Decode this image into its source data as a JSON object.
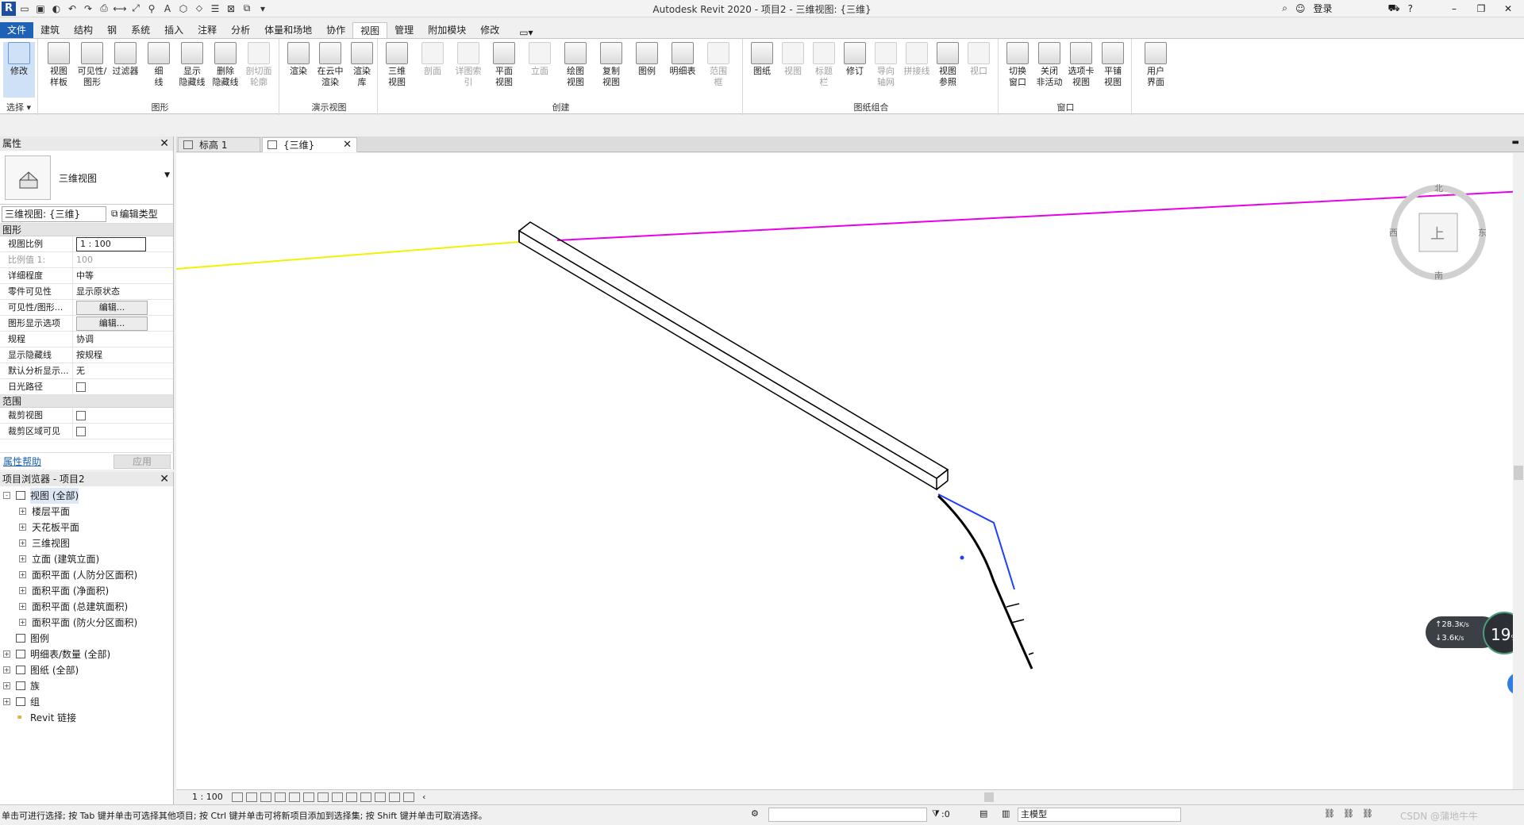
{
  "app": {
    "title": "Autodesk Revit 2020 - 项目2 - 三维视图: {三维}",
    "login": "登录",
    "logo": "R",
    "title_icons": [
      "binoculars-icon",
      "user-icon",
      "cart-icon",
      "help-icon"
    ]
  },
  "ribbon_tabs": [
    "文件",
    "建筑",
    "结构",
    "钢",
    "系统",
    "插入",
    "注释",
    "分析",
    "体量和场地",
    "协作",
    "视图",
    "管理",
    "附加模块",
    "修改"
  ],
  "ribbon": {
    "select": {
      "modify": "修改",
      "panel": "选择 ▾"
    },
    "graphics": {
      "panel": "图形",
      "buttons": [
        "视图\n样板",
        "可见性/\n图形",
        "过滤器",
        "细\n线",
        "显示\n隐藏线",
        "删除\n隐藏线",
        "剖切面\n轮廓"
      ]
    },
    "presentation": {
      "panel": "演示视图",
      "buttons": [
        "渲染",
        "在云中\n渲染",
        "渲染\n库"
      ]
    },
    "create": {
      "panel": "创建",
      "buttons": [
        "三维\n视图",
        "剖面",
        "详图索引",
        "平面\n视图",
        "立面",
        "绘图\n视图",
        "复制\n视图",
        "图例",
        "明细表",
        "范围\n框"
      ]
    },
    "sheet": {
      "panel": "图纸组合",
      "buttons": [
        "图纸",
        "视图",
        "标题\n栏",
        "修订",
        "导向\n轴网",
        "拼接线",
        "视图\n参照",
        "视口"
      ]
    },
    "windows": {
      "panel": "窗口",
      "buttons": [
        "切换\n窗口",
        "关闭\n非活动",
        "选项卡\n视图",
        "平铺\n视图"
      ]
    },
    "ui": {
      "buttons": [
        "用户\n界面"
      ]
    }
  },
  "properties": {
    "title": "属性",
    "type_name": "三维视图",
    "instance_selector": "三维视图: {三维}",
    "edit_type": "编辑类型",
    "groups": [
      {
        "name": "图形",
        "rows": [
          {
            "k": "视图比例",
            "v": "1 : 100"
          },
          {
            "k": "比例值 1:",
            "v": "100"
          },
          {
            "k": "详细程度",
            "v": "中等"
          },
          {
            "k": "零件可见性",
            "v": "显示原状态"
          },
          {
            "k": "可见性/图形...",
            "v": "编辑..."
          },
          {
            "k": "图形显示选项",
            "v": "编辑..."
          },
          {
            "k": "规程",
            "v": "协调"
          },
          {
            "k": "显示隐藏线",
            "v": "按规程"
          },
          {
            "k": "默认分析显示...",
            "v": "无"
          },
          {
            "k": "日光路径",
            "v": ""
          }
        ]
      },
      {
        "name": "范围",
        "rows": [
          {
            "k": "裁剪视图",
            "v": ""
          },
          {
            "k": "裁剪区域可见",
            "v": ""
          }
        ]
      }
    ],
    "help_link": "属性帮助",
    "apply": "应用"
  },
  "browser": {
    "title": "项目浏览器 - 项目2",
    "items": [
      {
        "label": "视图 (全部)",
        "level": 0,
        "exp": "-",
        "icon": "views-icon"
      },
      {
        "label": "楼层平面",
        "level": 1,
        "exp": "+"
      },
      {
        "label": "天花板平面",
        "level": 1,
        "exp": "+"
      },
      {
        "label": "三维视图",
        "level": 1,
        "exp": "+"
      },
      {
        "label": "立面 (建筑立面)",
        "level": 1,
        "exp": "+"
      },
      {
        "label": "面积平面 (人防分区面积)",
        "level": 1,
        "exp": "+"
      },
      {
        "label": "面积平面 (净面积)",
        "level": 1,
        "exp": "+"
      },
      {
        "label": "面积平面 (总建筑面积)",
        "level": 1,
        "exp": "+"
      },
      {
        "label": "面积平面 (防火分区面积)",
        "level": 1,
        "exp": "+"
      },
      {
        "label": "图例",
        "level": 0,
        "exp": "",
        "icon": "legend-icon"
      },
      {
        "label": "明细表/数量 (全部)",
        "level": 0,
        "exp": "+",
        "icon": "schedule-icon"
      },
      {
        "label": "图纸 (全部)",
        "level": 0,
        "exp": "+",
        "icon": "sheet-icon"
      },
      {
        "label": "族",
        "level": 0,
        "exp": "+",
        "icon": "family-icon"
      },
      {
        "label": "组",
        "level": 0,
        "exp": "+",
        "icon": "group-icon"
      },
      {
        "label": "Revit 链接",
        "level": 0,
        "exp": "",
        "icon": "link-icon"
      }
    ]
  },
  "doc_tabs": [
    {
      "label": "标高 1",
      "active": false
    },
    {
      "label": "{三维}",
      "active": true
    }
  ],
  "viewcube": {
    "face": "上",
    "compass": {
      "n": "北",
      "s": "南",
      "e": "东",
      "w": "西"
    }
  },
  "netmon": {
    "up": "28.3",
    "down": "3.6",
    "unit": "K/s",
    "percent": "19",
    "pct_sign": "%"
  },
  "view_control": {
    "scale": "1 : 100"
  },
  "status": {
    "message": "单击可进行选择; 按 Tab 键并单击可选择其他项目; 按 Ctrl 键并单击可将新项目添加到选择集; 按 Shift 键并单击可取消选择。",
    "zero": ":0",
    "model": "主模型",
    "watermark": "CSDN @蒲地牛牛"
  },
  "colors": {
    "accent": "#1e62b7",
    "magenta": "#e800e8",
    "yellow": "#f2f200",
    "blue": "#1f3fff"
  }
}
